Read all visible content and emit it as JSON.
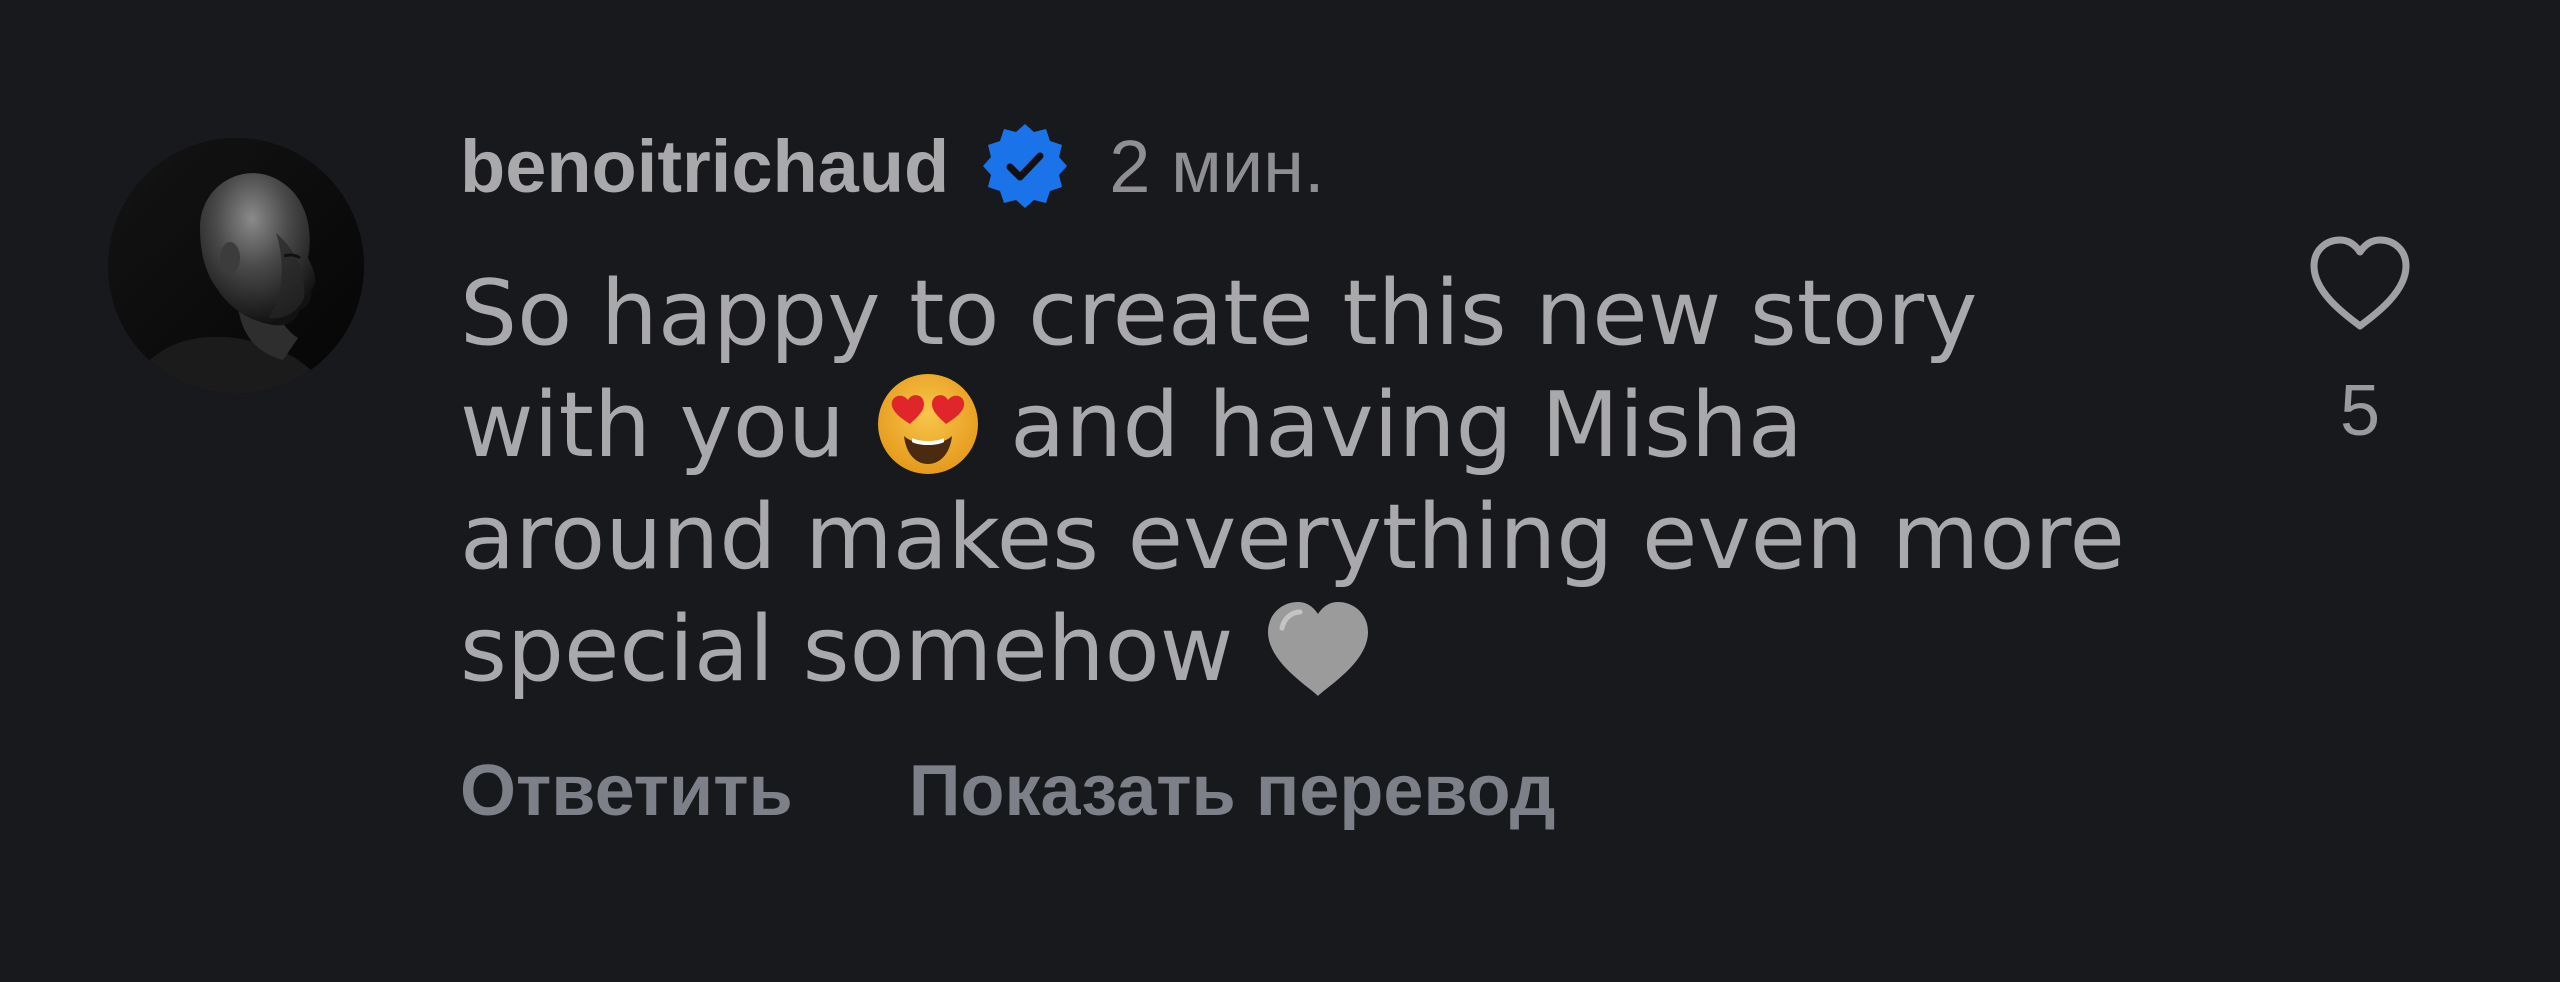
{
  "comment": {
    "username": "benoitrichaud",
    "verified": true,
    "time": "2 мин.",
    "text_lines": [
      {
        "before": "So happy to create this new story",
        "emoji": "",
        "after": ""
      },
      {
        "before": "with you ",
        "emoji": "heart-eyes",
        "after": " and having Misha"
      },
      {
        "before": "around makes everything even more",
        "emoji": "",
        "after": ""
      },
      {
        "before": "special somehow ",
        "emoji": "white-heart",
        "after": ""
      }
    ],
    "actions": {
      "reply": "Ответить",
      "translate": "Показать перевод"
    },
    "likes": "5",
    "icons": {
      "verified": "verified-badge-icon",
      "like": "heart-outline-icon"
    },
    "colors": {
      "background": "#18191c",
      "verified_badge": "#1a73e8",
      "text": "#a9a9ab",
      "action": "#7d8088"
    }
  }
}
